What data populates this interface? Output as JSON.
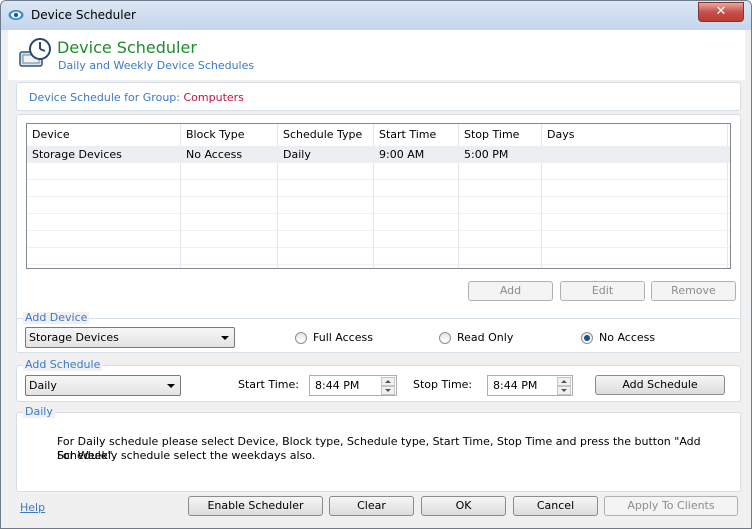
{
  "window": {
    "title": "Device Scheduler",
    "close_label": "✕"
  },
  "header": {
    "title": "Device Scheduler",
    "subtitle": "Daily and Weekly Device Schedules"
  },
  "group": {
    "label": "Device Schedule for Group:",
    "value": "Computers"
  },
  "schedule_table": {
    "columns": [
      "Device",
      "Block Type",
      "Schedule Type",
      "Start Time",
      "Stop Time",
      "Days"
    ],
    "rows": [
      {
        "device": "Storage Devices",
        "block_type": "No Access",
        "schedule_type": "Daily",
        "start_time": "9:00 AM",
        "stop_time": "5:00 PM",
        "days": ""
      }
    ]
  },
  "table_buttons": {
    "add": "Add",
    "edit": "Edit",
    "remove": "Remove"
  },
  "add_device": {
    "legend": "Add Device",
    "device_select": "Storage Devices",
    "options": {
      "full": "Full Access",
      "read": "Read Only",
      "none": "No Access"
    },
    "selected": "No Access"
  },
  "add_schedule": {
    "legend": "Add Schedule",
    "type_select": "Daily",
    "start_label": "Start Time:",
    "start_value": "8:44 PM",
    "stop_label": "Stop Time:",
    "stop_value": "8:44 PM",
    "button": "Add Schedule"
  },
  "info": {
    "legend": "Daily",
    "line1": "For Daily schedule please select Device, Block type, Schedule type, Start Time, Stop Time and press the button \"Add Schedule\".",
    "line2": "For Weekly schedule select the weekdays also."
  },
  "footer": {
    "help": "Help",
    "enable": "Enable Scheduler",
    "clear": "Clear",
    "ok": "OK",
    "cancel": "Cancel",
    "apply": "Apply To Clients"
  }
}
